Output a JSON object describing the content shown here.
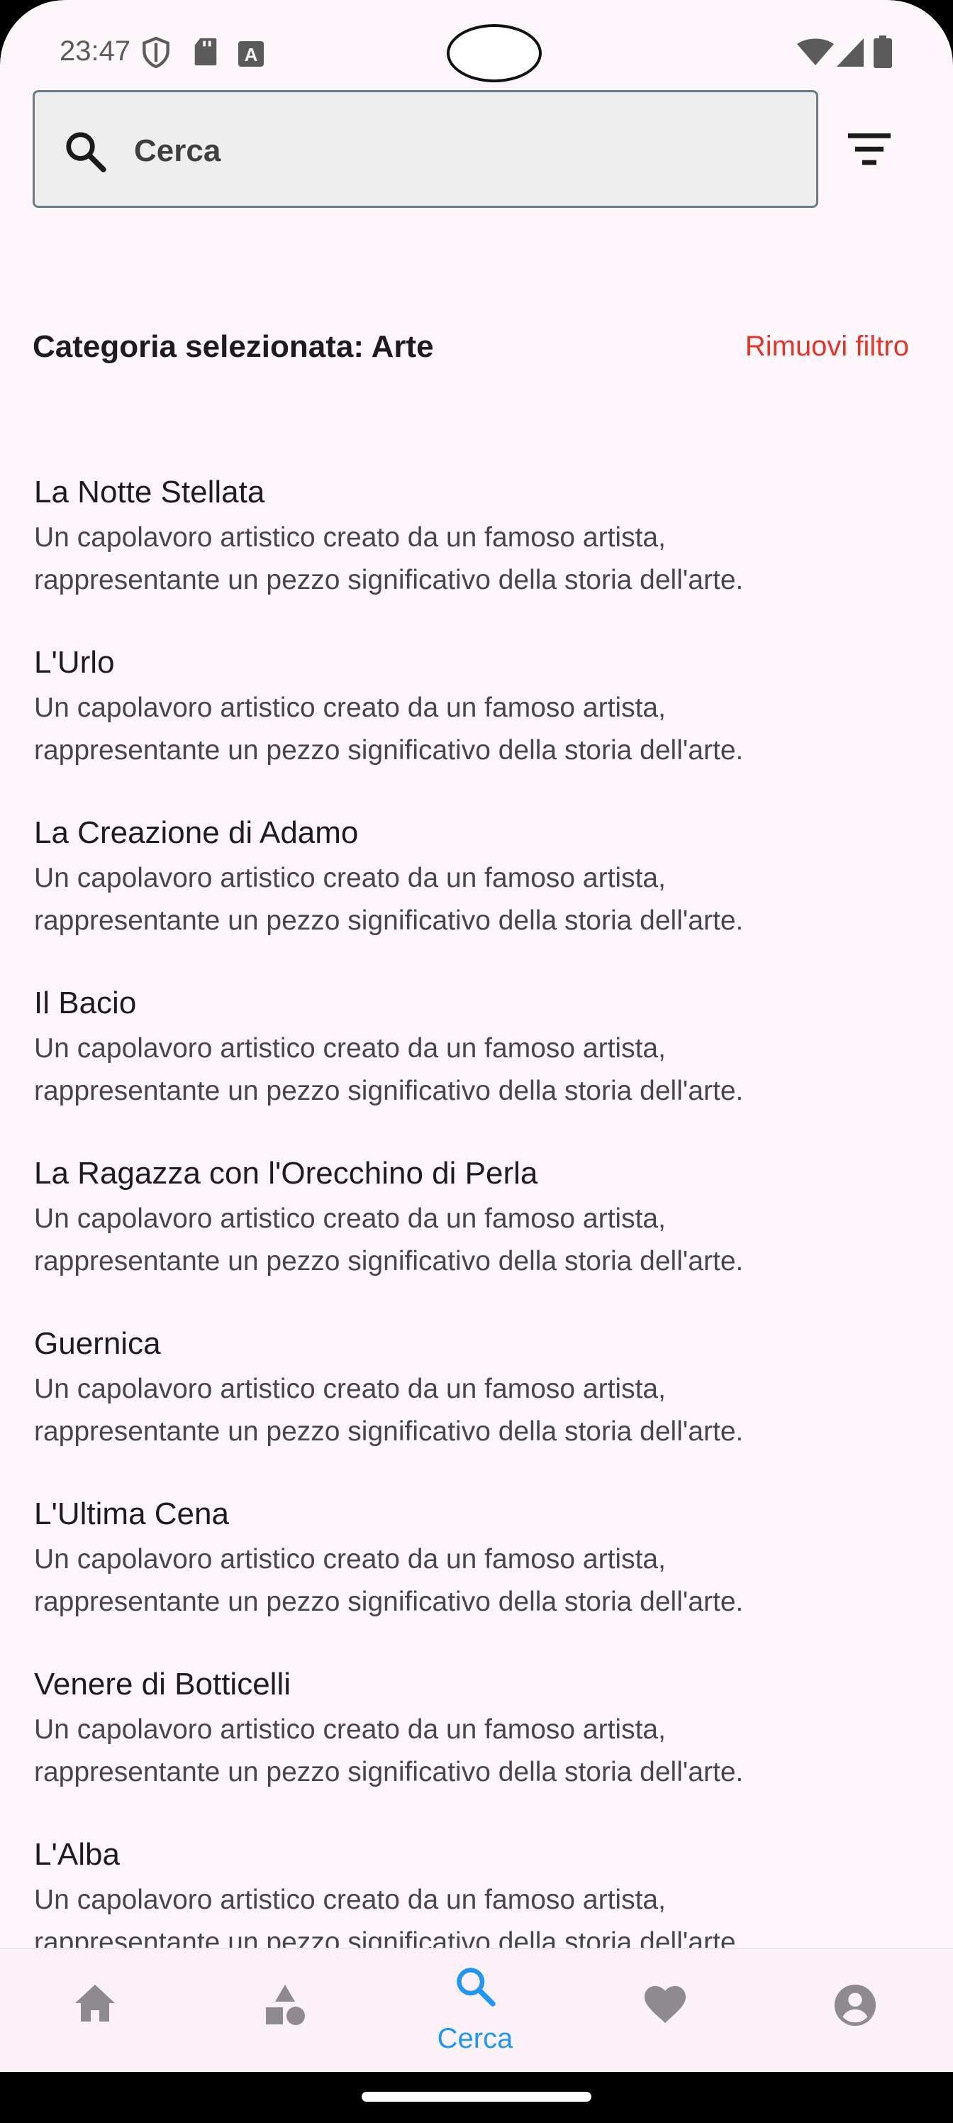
{
  "status_bar": {
    "time": "23:47",
    "left_icons": [
      "shield-icon",
      "sd-card-icon",
      "a-badge-icon"
    ],
    "right_icons": [
      "wifi-icon",
      "signal-icon",
      "battery-icon"
    ]
  },
  "search": {
    "placeholder": "Cerca",
    "value": ""
  },
  "filter": {
    "category_label": "Categoria selezionata: Arte",
    "remove_label": "Rimuovi filtro",
    "remove_color": "#e0362a"
  },
  "results": [
    {
      "title": "La Notte Stellata",
      "desc_line1": "Un capolavoro artistico creato da un famoso artista,",
      "desc_line2": "rappresentante un pezzo significativo della storia dell'arte."
    },
    {
      "title": "L'Urlo",
      "desc_line1": "Un capolavoro artistico creato da un famoso artista,",
      "desc_line2": "rappresentante un pezzo significativo della storia dell'arte."
    },
    {
      "title": "La Creazione di Adamo",
      "desc_line1": "Un capolavoro artistico creato da un famoso artista,",
      "desc_line2": "rappresentante un pezzo significativo della storia dell'arte."
    },
    {
      "title": "Il Bacio",
      "desc_line1": "Un capolavoro artistico creato da un famoso artista,",
      "desc_line2": "rappresentante un pezzo significativo della storia dell'arte."
    },
    {
      "title": "La Ragazza con l'Orecchino di Perla",
      "desc_line1": "Un capolavoro artistico creato da un famoso artista,",
      "desc_line2": "rappresentante un pezzo significativo della storia dell'arte."
    },
    {
      "title": "Guernica",
      "desc_line1": "Un capolavoro artistico creato da un famoso artista,",
      "desc_line2": "rappresentante un pezzo significativo della storia dell'arte."
    },
    {
      "title": "L'Ultima Cena",
      "desc_line1": "Un capolavoro artistico creato da un famoso artista,",
      "desc_line2": "rappresentante un pezzo significativo della storia dell'arte."
    },
    {
      "title": "Venere di Botticelli",
      "desc_line1": "Un capolavoro artistico creato da un famoso artista,",
      "desc_line2": "rappresentante un pezzo significativo della storia dell'arte."
    },
    {
      "title": "L'Alba",
      "desc_line1": "Un capolavoro artistico creato da un famoso artista,",
      "desc_line2": "rappresentante un pezzo significativo della storia dell'arte."
    }
  ],
  "bottom_nav": {
    "active_color": "#2196f3",
    "inactive_color": "#8f8a8e",
    "items": [
      {
        "icon": "home-icon",
        "label": ""
      },
      {
        "icon": "categories-icon",
        "label": ""
      },
      {
        "icon": "search-icon",
        "label": "Cerca",
        "active": true
      },
      {
        "icon": "heart-icon",
        "label": ""
      },
      {
        "icon": "account-icon",
        "label": ""
      }
    ]
  }
}
